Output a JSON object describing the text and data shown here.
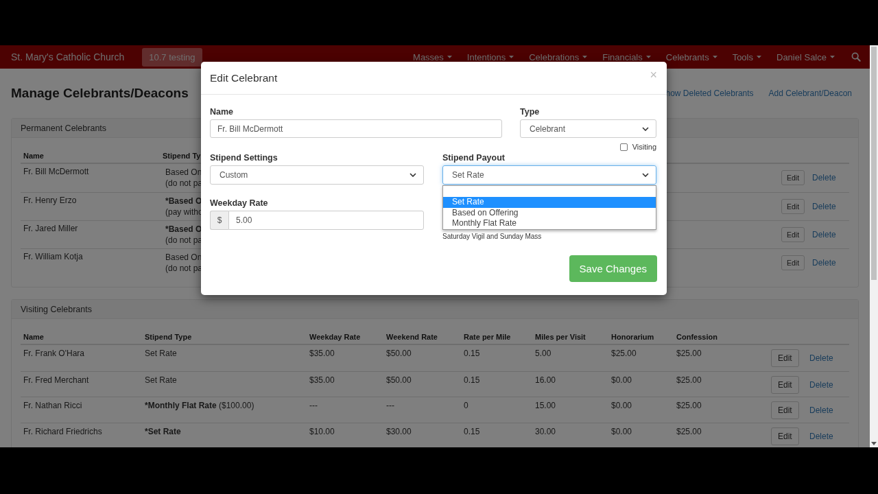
{
  "navbar": {
    "brand": "St. Mary's Catholic Church",
    "badge": "10.7 testing",
    "menus": [
      {
        "label": "Masses"
      },
      {
        "label": "Intentions"
      },
      {
        "label": "Celebrations"
      },
      {
        "label": "Financials"
      },
      {
        "label": "Celebrants"
      },
      {
        "label": "Tools"
      },
      {
        "label": "Daniel Salce"
      }
    ]
  },
  "page": {
    "title": "Manage Celebrants/Deacons",
    "links": [
      "how Deleted Celebrants",
      "Add Celebrant/Deacon"
    ]
  },
  "permanent": {
    "title": "Permanent Celebrants",
    "columns": [
      "Name",
      "Stipend Ty"
    ],
    "rows": [
      {
        "name": "Fr. Bill McDermott",
        "stipend": [
          "Based On",
          "(do not pa"
        ],
        "bold": false,
        "edit": "Edit",
        "delete": "Delete"
      },
      {
        "name": "Fr. Henry Erzo",
        "stipend": [
          "*Based O",
          "(pay witho"
        ],
        "bold": true,
        "edit": "Edit",
        "delete": "Delete"
      },
      {
        "name": "Fr. Jared Miller",
        "stipend": [
          "*Based O",
          "(do not pa"
        ],
        "bold": true,
        "edit": "Edit",
        "delete": "Delete"
      },
      {
        "name": "Fr. William Kotja",
        "stipend": [
          "Based On",
          "(do not pa"
        ],
        "bold": false,
        "edit": "Edit",
        "delete": "Delete"
      }
    ]
  },
  "visiting": {
    "title": "Visiting Celebrants",
    "columns": [
      "Name",
      "Stipend Type",
      "Weekday Rate",
      "Weekend Rate",
      "Rate per Mile",
      "Miles per Visit",
      "Honorarium",
      "Confession"
    ],
    "rows": [
      {
        "cells": [
          "Fr. Frank O'Hara",
          "Set Rate",
          "$35.00",
          "$50.00",
          "0.15",
          "5.00",
          "$25.00",
          "$25.00"
        ],
        "bold": false,
        "edit": "Edit",
        "delete": "Delete"
      },
      {
        "cells": [
          "Fr. Fred Merchant",
          "Set Rate",
          "$35.00",
          "$50.00",
          "0.15",
          "16.00",
          "$0.00",
          "$25.00"
        ],
        "bold": false,
        "edit": "Edit",
        "delete": "Delete"
      },
      {
        "cells": [
          "Fr. Nathan Ricci",
          "*Monthly Flat Rate",
          "---",
          "---",
          "0",
          "15.00",
          "$0.00",
          "$25.00"
        ],
        "bold": true,
        "note": "($100.00)",
        "edit": "Edit",
        "delete": "Delete"
      },
      {
        "cells": [
          "Fr. Richard Friedrichs",
          "*Set Rate",
          "$10.00",
          "$30.00",
          "0.15",
          "30.00",
          "$0.00",
          "$25.00"
        ],
        "bold": true,
        "edit": "Edit",
        "delete": "Delete"
      }
    ]
  },
  "modal": {
    "title": "Edit Celebrant",
    "close": "×",
    "name": {
      "label": "Name",
      "value": "Fr. Bill McDermott"
    },
    "type": {
      "label": "Type",
      "value": "Celebrant"
    },
    "visiting": {
      "label": "Visiting",
      "checked": false
    },
    "stipend_settings": {
      "label": "Stipend Settings",
      "value": "Custom"
    },
    "stipend_payout": {
      "label": "Stipend Payout",
      "value": "Set Rate"
    },
    "payout_options": [
      {
        "label": "Set Rate",
        "selected": true
      },
      {
        "label": "Based on Offering",
        "selected": false
      },
      {
        "label": "Monthly Flat Rate",
        "selected": false
      }
    ],
    "weekday_rate": {
      "label": "Weekday Rate",
      "prefix": "$",
      "value": "5.00"
    },
    "note": "Saturday Vigil and Sunday Mass",
    "save": "Save Changes"
  }
}
